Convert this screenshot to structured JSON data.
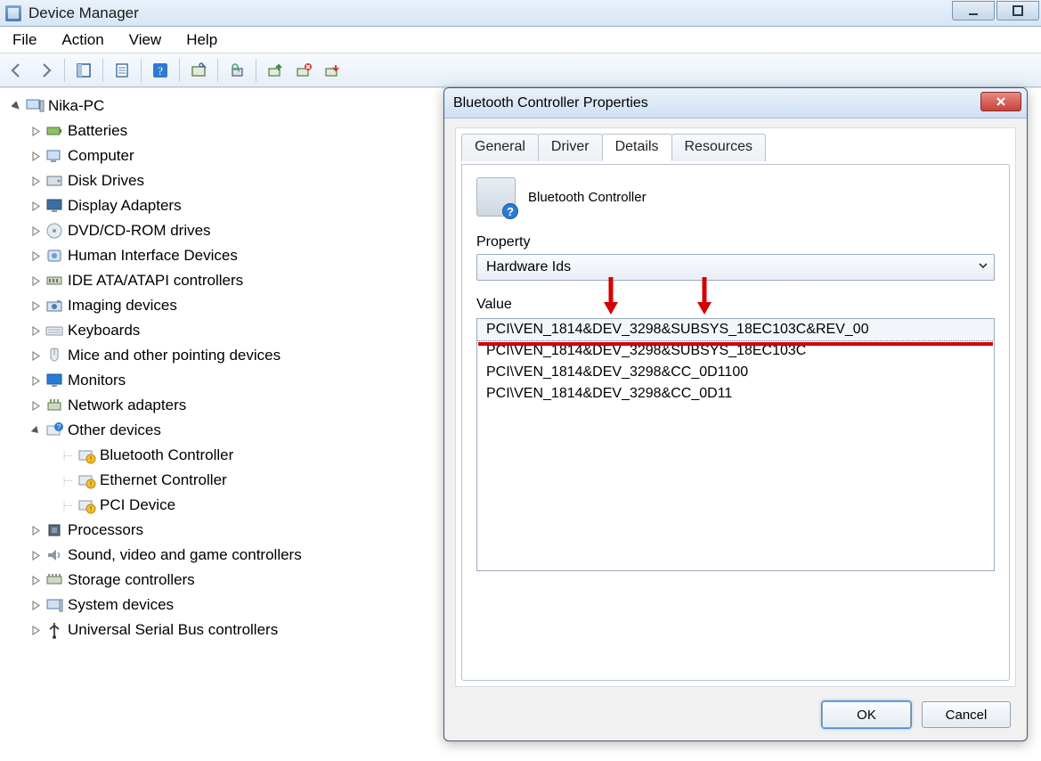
{
  "app": {
    "title": "Device Manager"
  },
  "menu": {
    "file": "File",
    "action": "Action",
    "view": "View",
    "help": "Help"
  },
  "toolbar_icons": {
    "back": "back-icon",
    "forward": "forward-icon",
    "show_hidden": "properties-pane-icon",
    "properties": "properties-icon",
    "help": "help-icon",
    "scan": "scan-hardware-icon",
    "find": "find-icon",
    "update": "update-driver-icon",
    "uninstall": "uninstall-icon",
    "disable": "disable-icon"
  },
  "tree": {
    "root": "Nika-PC",
    "items": [
      {
        "label": "Batteries"
      },
      {
        "label": "Computer"
      },
      {
        "label": "Disk Drives"
      },
      {
        "label": "Display Adapters"
      },
      {
        "label": "DVD/CD-ROM drives"
      },
      {
        "label": "Human Interface Devices"
      },
      {
        "label": "IDE ATA/ATAPI controllers"
      },
      {
        "label": "Imaging devices"
      },
      {
        "label": "Keyboards"
      },
      {
        "label": "Mice and other pointing devices"
      },
      {
        "label": "Monitors"
      },
      {
        "label": "Network adapters"
      },
      {
        "label": "Other devices",
        "expanded": true,
        "children": [
          {
            "label": "Bluetooth Controller"
          },
          {
            "label": "Ethernet Controller"
          },
          {
            "label": "PCI Device"
          }
        ]
      },
      {
        "label": "Processors"
      },
      {
        "label": "Sound, video and game controllers"
      },
      {
        "label": "Storage controllers"
      },
      {
        "label": "System devices"
      },
      {
        "label": "Universal Serial Bus controllers"
      }
    ]
  },
  "dialog": {
    "title": "Bluetooth Controller Properties",
    "tabs": {
      "general": "General",
      "driver": "Driver",
      "details": "Details",
      "resources": "Resources"
    },
    "device_name": "Bluetooth Controller",
    "property_label": "Property",
    "property_value": "Hardware Ids",
    "value_label": "Value",
    "values": [
      "PCI\\VEN_1814&DEV_3298&SUBSYS_18EC103C&REV_00",
      "PCI\\VEN_1814&DEV_3298&SUBSYS_18EC103C",
      "PCI\\VEN_1814&DEV_3298&CC_0D1100",
      "PCI\\VEN_1814&DEV_3298&CC_0D11"
    ],
    "buttons": {
      "ok": "OK",
      "cancel": "Cancel"
    }
  }
}
